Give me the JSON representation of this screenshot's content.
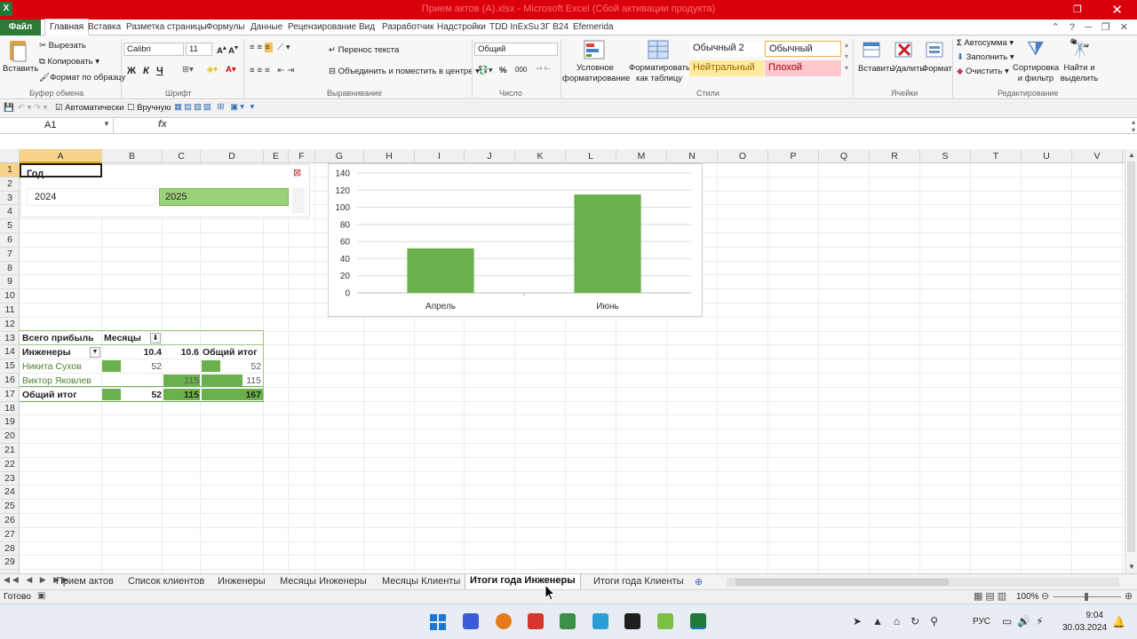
{
  "window": {
    "title": "Прием актов (A).xlsx  -  Microsoft Excel (Сбой активации продукта)",
    "app_icon": "excel-icon"
  },
  "tabs": [
    "Файл",
    "Главная",
    "Вставка",
    "Разметка страницы",
    "Формулы",
    "Данные",
    "Рецензирование",
    "Вид",
    "Разработчик",
    "Надстройки",
    "TDD InExSu",
    "ЗГ В24",
    "Efemerida"
  ],
  "ribbon": {
    "clipboard": {
      "paste": "Вставить",
      "cut": "Вырезать",
      "copy": "Копировать",
      "format_painter": "Формат по образцу",
      "group": "Буфер обмена"
    },
    "font": {
      "name": "Calibri",
      "size": "11",
      "bold": "Ж",
      "italic": "К",
      "underline": "Ч",
      "group": "Шрифт"
    },
    "alignment": {
      "wrap": "Перенос текста",
      "merge": "Объединить и поместить в центре",
      "group": "Выравнивание"
    },
    "number": {
      "format": "Общий",
      "percent": "%",
      "thousands": "000",
      "group": "Число"
    },
    "styles": {
      "conditional": "Условное форматирование",
      "as_table": "Форматировать как таблицу",
      "normal2": "Обычный 2",
      "normal": "Обычный",
      "neutral": "Нейтральный",
      "bad": "Плохой",
      "group": "Стили"
    },
    "cells": {
      "insert": "Вставить",
      "delete": "Удалить",
      "format": "Формат",
      "group": "Ячейки"
    },
    "editing": {
      "autosum": "Автосумма",
      "fill": "Заполнить",
      "clear": "Очистить",
      "sort": "Сортировка и фильтр",
      "find": "Найти и выделить",
      "group": "Редактирование"
    }
  },
  "qat": {
    "auto": "Автоматически",
    "manual": "Вручную"
  },
  "formula_bar": {
    "name_box": "A1",
    "fx": "fx",
    "value": ""
  },
  "columns": [
    "A",
    "B",
    "C",
    "D",
    "E",
    "F",
    "G",
    "H",
    "I",
    "J",
    "K",
    "L",
    "M",
    "N",
    "O",
    "P",
    "Q",
    "R",
    "S",
    "T",
    "U",
    "V"
  ],
  "rows": [
    "1",
    "2",
    "3",
    "4",
    "5",
    "6",
    "7",
    "8",
    "9",
    "10",
    "11",
    "12",
    "13",
    "14",
    "15",
    "16",
    "17",
    "18",
    "19",
    "20",
    "21",
    "22",
    "23",
    "24",
    "25",
    "26",
    "27",
    "28",
    "29"
  ],
  "slicer": {
    "title": "Год",
    "items": [
      "2024",
      "2025"
    ],
    "selected": "2025"
  },
  "pivot": {
    "header_total": "Всего прибыль",
    "header_months": "Месяцы",
    "row_label": "Инженеры",
    "col_values": [
      "10.4",
      "10.6",
      "Общий итог"
    ],
    "rows": [
      {
        "name": "Никита Сухов",
        "c1": "52",
        "c2": "",
        "total": "52"
      },
      {
        "name": "Виктор Яковлев",
        "c1": "",
        "c2": "115",
        "total": "115"
      }
    ],
    "grand": {
      "name": "Общий итог",
      "c1": "52",
      "c2": "115",
      "total": "167"
    }
  },
  "chart_data": {
    "type": "bar",
    "categories": [
      "Апрель",
      "Июнь"
    ],
    "values": [
      52,
      115
    ],
    "title": "",
    "xlabel": "",
    "ylabel": "",
    "ylim": [
      0,
      140
    ],
    "yticks": [
      "0",
      "20",
      "40",
      "60",
      "80",
      "100",
      "120",
      "140"
    ],
    "grid": true,
    "color": "#6ab04c"
  },
  "sheets": [
    "Прием актов",
    "Список клиентов",
    "Инженеры",
    "Месяцы Инженеры",
    "Месяцы Клиенты",
    "Итоги года Инженеры",
    "Итоги года Клиенты"
  ],
  "active_sheet": "Итоги года Инженеры",
  "status": {
    "ready": "Готово",
    "zoom": "100%"
  },
  "taskbar": {
    "lang": "РУС",
    "time": "9:04",
    "date": "30.03.2024"
  }
}
